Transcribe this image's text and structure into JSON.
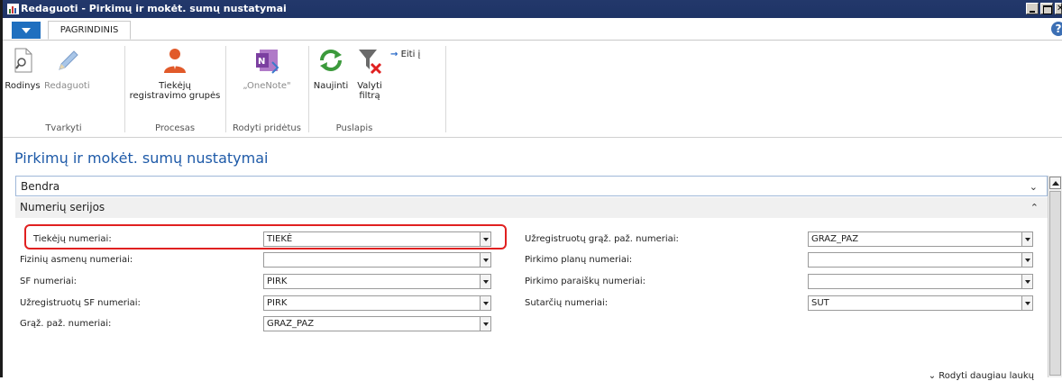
{
  "window": {
    "title": "Redaguoti - Pirkimų ir mokėt. sumų nustatymai"
  },
  "ribbon": {
    "tab": "PAGRINDINIS",
    "help": "?",
    "groups": {
      "tvarkyti": {
        "name": "Tvarkyti",
        "rodinys": "Rodinys",
        "redaguoti": "Redaguoti"
      },
      "procesas": {
        "name": "Procesas",
        "tiekeju_line1": "Tiekėjų",
        "tiekeju_line2": "registravimo grupės"
      },
      "rodyti": {
        "name": "Rodyti pridėtus",
        "onenote": "„OneNote\""
      },
      "puslapis": {
        "name": "Puslapis",
        "naujinti": "Naujinti",
        "valyti_line1": "Valyti",
        "valyti_line2": "filtrą",
        "eiti": "Eiti į"
      }
    }
  },
  "page": {
    "title": "Pirkimų ir mokėt. sumų nustatymai",
    "fasttab_general": "Bendra",
    "fasttab_numbers": "Numerių serijos",
    "show_more": "Rodyti daugiau laukų"
  },
  "fields_left": [
    {
      "label": "Tiekėjų numeriai:",
      "value": "TIEKĖ"
    },
    {
      "label": "Fizinių asmenų numeriai:",
      "value": ""
    },
    {
      "label": "SF numeriai:",
      "value": "PIRK"
    },
    {
      "label": "Užregistruotų SF numeriai:",
      "value": "PIRK"
    },
    {
      "label": "Grąž. paž. numeriai:",
      "value": "GRAZ_PAZ"
    }
  ],
  "fields_right": [
    {
      "label": "Užregistruotų grąž. paž. numeriai:",
      "value": "GRAZ_PAZ"
    },
    {
      "label": "Pirkimo planų numeriai:",
      "value": ""
    },
    {
      "label": "Pirkimo paraiškų numeriai:",
      "value": ""
    },
    {
      "label": "Sutarčių numeriai:",
      "value": "SUT"
    }
  ],
  "colors": {
    "accent": "#1e5aa8",
    "titlebar": "#1e3466",
    "highlight": "#e02020"
  }
}
